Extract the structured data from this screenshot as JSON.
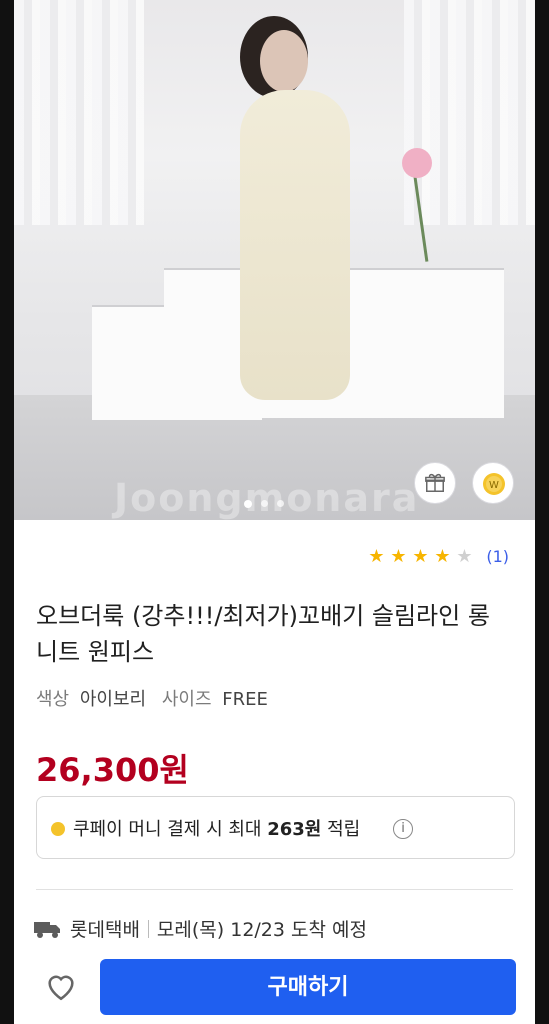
{
  "hero": {
    "watermark": "Joongmonara",
    "slides": 3,
    "active_slide": 1
  },
  "rating": {
    "stars": 4,
    "max_stars": 5,
    "review_count": "(1)"
  },
  "product": {
    "title": "오브더룩 (강추!!!/최저가)꼬배기 슬림라인 롱 니트 원피스",
    "color_label": "색상",
    "color_value": "아이보리",
    "size_label": "사이즈",
    "size_value": "FREE",
    "price": "26,300원"
  },
  "benefit": {
    "text_before": "쿠페이 머니 결제 시 최대",
    "amount": "263원",
    "text_after": "적립",
    "info": "i"
  },
  "delivery": {
    "carrier": "롯데택배",
    "eta": "모레(목) 12/23 도착 예정"
  },
  "actions": {
    "buy_label": "구매하기"
  },
  "colors": {
    "price": "#b3001f",
    "buy_button": "#1f5ff0",
    "star": "#f7b500",
    "link": "#3b5ee8"
  }
}
